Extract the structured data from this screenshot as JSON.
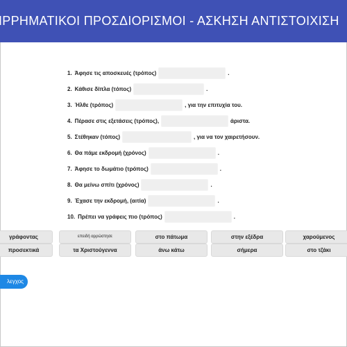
{
  "header": {
    "title": "ΙΡΡΗΜΑΤΙΚΟΙ ΠΡΟΣΔΙΟΡΙΣΜΟΙ - ΑΣΚΗΣΗ ΑΝΤΙΣΤΟΙΧΙΣΗ"
  },
  "exercise": {
    "items": [
      {
        "num": "1.",
        "before": "Άφησε τις αποσκευές (τρόπος)",
        "after": "."
      },
      {
        "num": "2.",
        "before": "Κάθισε δίπλα (τόπος)",
        "after": "."
      },
      {
        "num": "3.",
        "before": "Ήλθε (τρόπος)",
        "after": ", για την επιτυχία του."
      },
      {
        "num": "4.",
        "before": "Πέρασε στις εξετάσεις (τρόπος),",
        "after": "άριστα."
      },
      {
        "num": "5.",
        "before": "Στέθηκαν (τόπος)",
        "after": ", για να τον χαιρετήσουν."
      },
      {
        "num": "6.",
        "before": "Θα πάμε εκδρομή (χρόνος)",
        "after": "."
      },
      {
        "num": "7.",
        "before": "Άφησε το δωμάτιο (τρόπος)",
        "after": "."
      },
      {
        "num": "8.",
        "before": "Θα μείνω σπίτι (χρόνος)",
        "after": "."
      },
      {
        "num": "9.",
        "before": "Έχασε την εκδρομή, (αιτία)",
        "after": "."
      },
      {
        "num": "10.",
        "before": "Πρέπει να γράφεις πιο (τρόπος)",
        "after": "."
      }
    ]
  },
  "answers": [
    "γράφοντας",
    "επειδή αρρώστησε",
    "στο πάτωμα",
    "στην εξέδρα",
    "χαρούμενος",
    "προσεκτικά",
    "τα Χριστούγεννα",
    "άνω κάτω",
    "σήμερα",
    "στο τζάκι"
  ],
  "check_button": {
    "label": "λεγχος"
  }
}
